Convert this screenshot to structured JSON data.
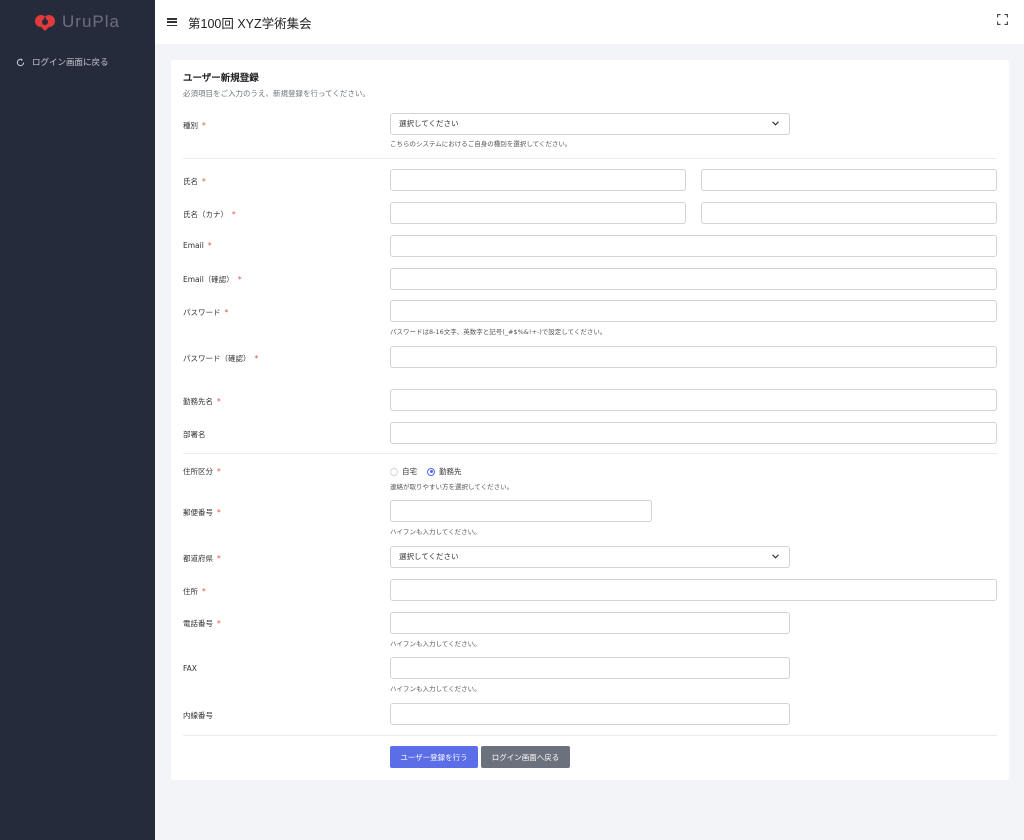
{
  "sidebar": {
    "logo_text": "UruPla",
    "back_label": "ログイン画面に戻る"
  },
  "header": {
    "title": "第100回 XYZ学術集会"
  },
  "form": {
    "title": "ユーザー新規登録",
    "subtitle": "必須項目をご入力のうえ、新規登録を行ってください。",
    "required_mark": "*",
    "fields": {
      "type_label": "種別",
      "type_value": "選択してください",
      "type_help": "こちらのシステムにおけるご自身の種別を選択してください。",
      "name_label": "氏名",
      "kana_label": "氏名（カナ）",
      "email_label": "Email",
      "email_confirm_label": "Email（確認）",
      "password_label": "パスワード",
      "password_help": "パスワードは8-16文字、英数字と記号(_#$%&!+-)で設定してください。",
      "password_confirm_label": "パスワード（確認）",
      "company_label": "勤務先名",
      "department_label": "部署名",
      "address_type_label": "住所区分",
      "address_type_home": "自宅",
      "address_type_work": "勤務先",
      "address_type_selected": "勤務先",
      "address_type_help": "連絡が取りやすい方を選択してください。",
      "postal_label": "郵便番号",
      "postal_help": "ハイフンも入力してください。",
      "prefecture_label": "都道府県",
      "prefecture_value": "選択してください",
      "address_label": "住所",
      "phone_label": "電話番号",
      "phone_help": "ハイフンも入力してください。",
      "fax_label": "FAX",
      "fax_help": "ハイフンも入力してください。",
      "extension_label": "内線番号"
    },
    "submit_label": "ユーザー登録を行う",
    "back_label": "ログイン画面へ戻る"
  },
  "colors": {
    "sidebar_bg": "#262b3c",
    "logo_red": "#e03a3a",
    "primary": "#5b6ee8",
    "secondary": "#6c727d",
    "required": "#e74c3c"
  }
}
